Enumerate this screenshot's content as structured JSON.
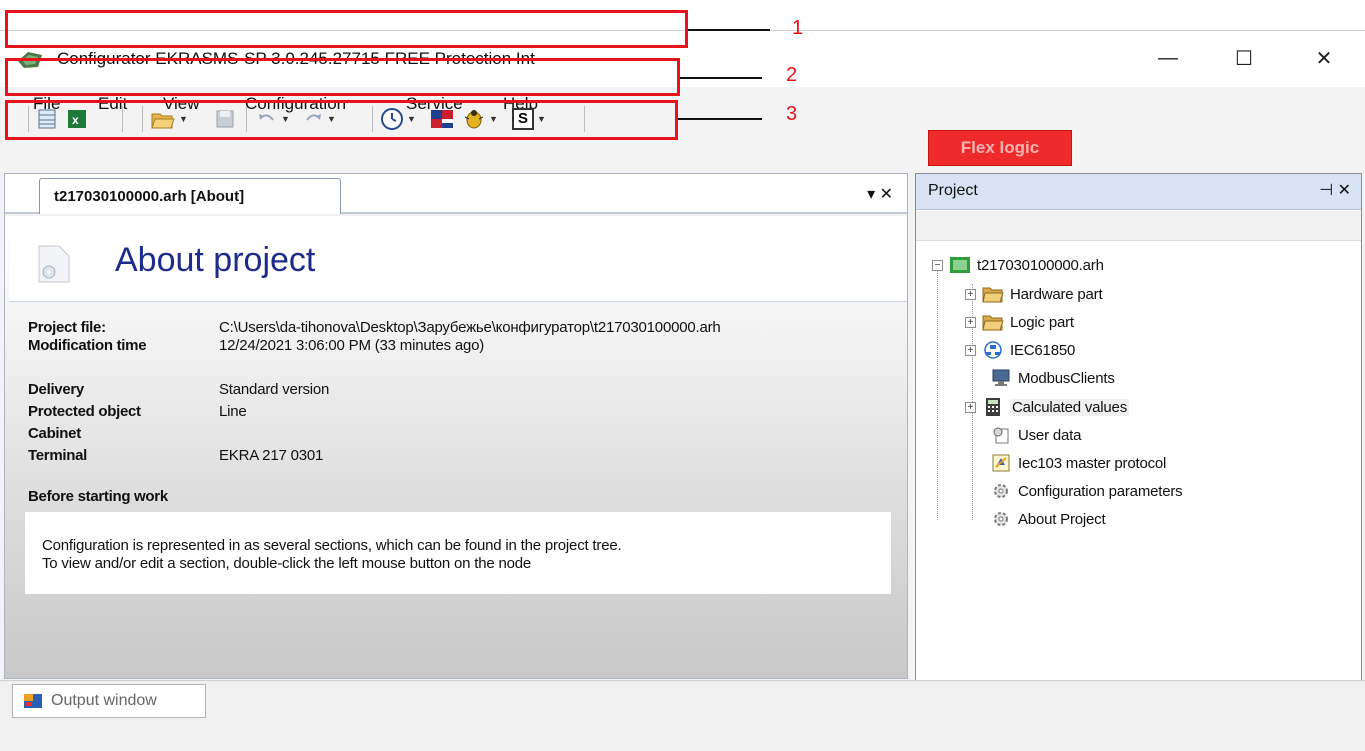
{
  "window": {
    "title": "Configurator EKRASMS-SP 3.0.245.27715 FREE Protection Int",
    "controls": {
      "minimize": "—",
      "maximize": "☐",
      "close": "✕"
    }
  },
  "menu": [
    "File",
    "Edit",
    "View",
    "Configuration",
    "Service",
    "Help"
  ],
  "toolbar": {
    "flex_logic_label": "Flex logic",
    "s_label": "S"
  },
  "annotations": [
    "1",
    "2",
    "3"
  ],
  "document": {
    "tab_label": "t217030100000.arh [About]",
    "tab_controls": "▾ ✕",
    "heading": "About project",
    "fields": [
      {
        "label": "Project file:",
        "value": "C:\\Users\\da-tihonova\\Desktop\\Зарубежье\\конфигуратор\\t217030100000.arh"
      },
      {
        "label": "Modification time",
        "value": "12/24/2021 3:06:00 PM (33 minutes ago)"
      },
      {
        "label": "Delivery",
        "value": "Standard version"
      },
      {
        "label": "Protected object",
        "value": "Line"
      },
      {
        "label": "Cabinet",
        "value": ""
      },
      {
        "label": "Terminal",
        "value": "EKRA 217 0301"
      }
    ],
    "before_heading": "Before starting work",
    "note_lines": [
      "Configuration is represented in as several sections, which can be found in the project tree.",
      "To view and/or edit a section, double-click the left mouse button on the node"
    ]
  },
  "project_panel": {
    "title": "Project",
    "controls": "⊣ ✕",
    "tree": {
      "root": "t217030100000.arh",
      "items": [
        {
          "label": "Hardware part",
          "icon": "folder-icon",
          "expandable": true
        },
        {
          "label": "Logic part",
          "icon": "folder-icon",
          "expandable": true
        },
        {
          "label": "IEC61850",
          "icon": "network-icon",
          "expandable": true
        },
        {
          "label": "ModbusClients",
          "icon": "monitor-icon",
          "expandable": false
        },
        {
          "label": "Calculated values",
          "icon": "calculator-icon",
          "expandable": true
        },
        {
          "label": "User data",
          "icon": "user-data-icon",
          "expandable": false
        },
        {
          "label": "Iec103 master protocol",
          "icon": "protocol-icon",
          "expandable": false
        },
        {
          "label": "Configuration parameters",
          "icon": "gear-icon",
          "expandable": false
        },
        {
          "label": "About Project",
          "icon": "gear-icon",
          "expandable": false
        }
      ]
    }
  },
  "output_window": {
    "label": "Output window"
  },
  "colors": {
    "accent_red": "#ee2a2a",
    "heading_blue": "#1c2b8c",
    "panel_header": "#d8e4f5",
    "annotation_red": "#e8121a"
  }
}
